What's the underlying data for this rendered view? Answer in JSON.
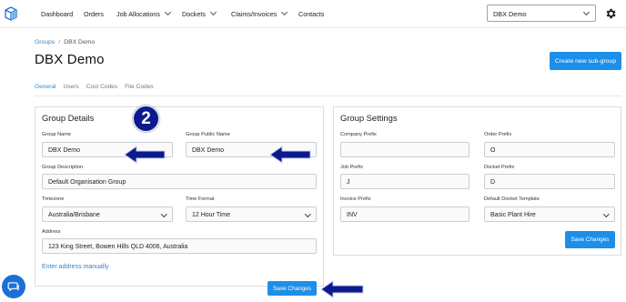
{
  "nav": {
    "items": [
      {
        "label": "Dashboard",
        "dropdown": false
      },
      {
        "label": "Orders",
        "dropdown": false
      },
      {
        "label": "Job Allocations",
        "dropdown": true
      },
      {
        "label": "Dockets",
        "dropdown": true
      },
      {
        "label": "Claims/Invoices",
        "dropdown": true
      },
      {
        "label": "Contacts",
        "dropdown": false
      }
    ],
    "group_selector": "DBX Demo",
    "icons": {
      "logo": "cube-logo-icon",
      "settings": "gear-icon"
    }
  },
  "breadcrumb": {
    "parent": "Groups",
    "separator": "/",
    "current": "DBX Demo"
  },
  "page_title": "DBX Demo",
  "create_button": "Create new sub-group",
  "tabs": [
    {
      "label": "General",
      "active": true
    },
    {
      "label": "Users",
      "active": false
    },
    {
      "label": "Cost Codes",
      "active": false
    },
    {
      "label": "File Codes",
      "active": false
    }
  ],
  "group_details": {
    "title": "Group Details",
    "group_name": {
      "label": "Group Name",
      "value": "DBX Demo"
    },
    "group_public_name": {
      "label": "Group Public Name",
      "value": "DBX Demo"
    },
    "group_description": {
      "label": "Group Description",
      "value": "Default Organisation Group"
    },
    "timezone": {
      "label": "Timezone",
      "value": "Australia/Brisbane"
    },
    "time_format": {
      "label": "Time Format",
      "value": "12 Hour Time"
    },
    "address": {
      "label": "Address",
      "value": "123 King Street, Bowen Hills QLD 4006, Australia"
    },
    "manual_link": "Enter address manually",
    "save": "Save Changes"
  },
  "group_settings": {
    "title": "Group Settings",
    "company_prefix": {
      "label": "Company Prefix",
      "value": ""
    },
    "order_prefix": {
      "label": "Order Prefix",
      "value": "O"
    },
    "job_prefix": {
      "label": "Job Prefix",
      "value": "J"
    },
    "docket_prefix": {
      "label": "Docket Prefix",
      "value": "D"
    },
    "invoice_prefix": {
      "label": "Invoice Prefix",
      "value": "INV"
    },
    "default_docket_template": {
      "label": "Default Docket Template",
      "value": "Basic Plant Hire"
    },
    "save": "Save Changes"
  },
  "annotation": {
    "step_number": "2",
    "arrow_color": "#0c1a8e",
    "badge_color": "#0c1a8e"
  },
  "colors": {
    "accent": "#1d8fe8",
    "link": "#3b82c4"
  }
}
